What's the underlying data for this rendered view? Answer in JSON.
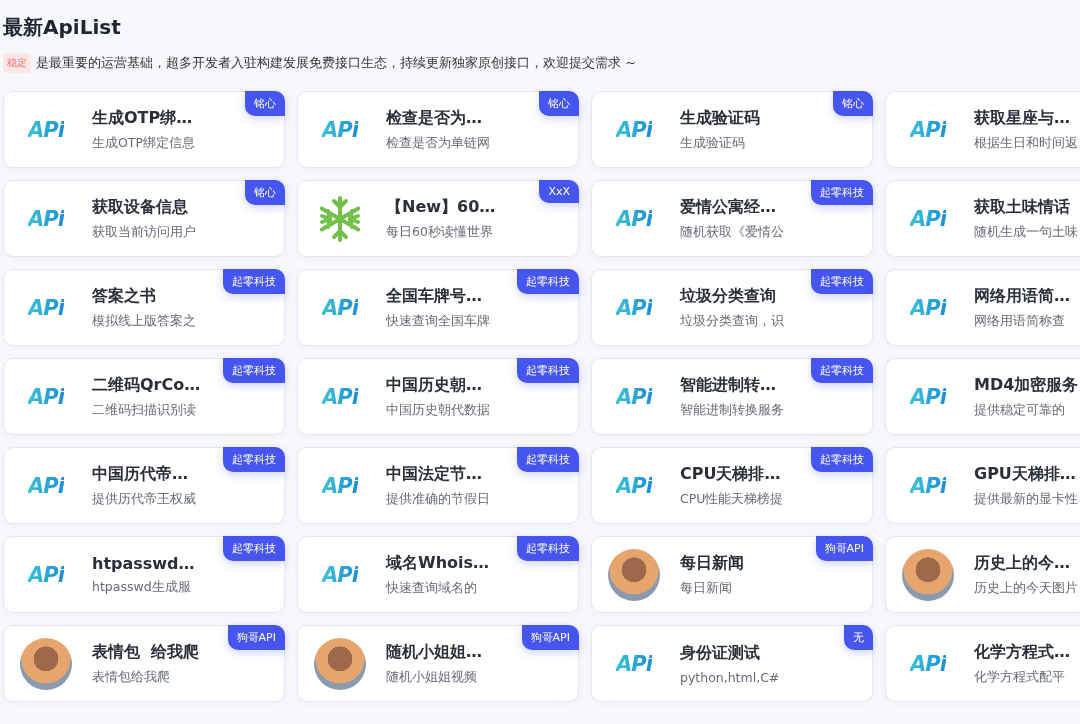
{
  "heading": "最新ApiList",
  "notice": {
    "tag": "稳定",
    "text": "是最重要的运营基础，超多开发者入驻构建发展免费接口生态，持续更新独家原创接口，欢迎提交需求 ~"
  },
  "cards": [
    {
      "kind": "api",
      "logo": "APi",
      "title": "生成OTP绑…",
      "desc": "生成OTP绑定信息",
      "badge": "铭心"
    },
    {
      "kind": "api",
      "logo": "APi",
      "title": "检查是否为…",
      "desc": "检查是否为单链网",
      "badge": "铭心"
    },
    {
      "kind": "api",
      "logo": "APi",
      "title": "生成验证码",
      "desc": "生成验证码",
      "badge": "铭心"
    },
    {
      "kind": "api",
      "logo": "APi",
      "title": "获取星座与…",
      "desc": "根据生日和时间返"
    },
    {
      "kind": "api",
      "logo": "APi",
      "title": "获取设备信息",
      "desc": "获取当前访问用户",
      "badge": "铭心"
    },
    {
      "kind": "snowflake",
      "title": "【New】60…",
      "desc": "每日60秒读懂世界",
      "badge": "XxX"
    },
    {
      "kind": "api",
      "logo": "APi",
      "title": "爱情公寓经…",
      "desc": "随机获取《爱情公",
      "badge": "起零科技"
    },
    {
      "kind": "api",
      "logo": "APi",
      "title": "获取土味情话",
      "desc": "随机生成一句土味"
    },
    {
      "kind": "api",
      "logo": "APi",
      "title": "答案之书",
      "desc": "模拟线上版答案之",
      "badge": "起零科技"
    },
    {
      "kind": "api",
      "logo": "APi",
      "title": "全国车牌号…",
      "desc": "快速查询全国车牌",
      "badge": "起零科技"
    },
    {
      "kind": "api",
      "logo": "APi",
      "title": "垃圾分类查询",
      "desc": "垃圾分类查询，识",
      "badge": "起零科技"
    },
    {
      "kind": "api",
      "logo": "APi",
      "title": "网络用语简…",
      "desc": "网络用语简称查"
    },
    {
      "kind": "api",
      "logo": "APi",
      "title": "二维码QrCo…",
      "desc": "二维码扫描识别读",
      "badge": "起零科技"
    },
    {
      "kind": "api",
      "logo": "APi",
      "title": "中国历史朝…",
      "desc": "中国历史朝代数据",
      "badge": "起零科技"
    },
    {
      "kind": "api",
      "logo": "APi",
      "title": "智能进制转…",
      "desc": "智能进制转换服务",
      "badge": "起零科技"
    },
    {
      "kind": "api",
      "logo": "APi",
      "title": "MD4加密服务",
      "desc": "提供稳定可靠的"
    },
    {
      "kind": "api",
      "logo": "APi",
      "title": "中国历代帝…",
      "desc": "提供历代帝王权威",
      "badge": "起零科技"
    },
    {
      "kind": "api",
      "logo": "APi",
      "title": "中国法定节…",
      "desc": "提供准确的节假日",
      "badge": "起零科技"
    },
    {
      "kind": "api",
      "logo": "APi",
      "title": "CPU天梯排…",
      "desc": "CPU性能天梯榜提",
      "badge": "起零科技"
    },
    {
      "kind": "api",
      "logo": "APi",
      "title": "GPU天梯排…",
      "desc": "提供最新的显卡性"
    },
    {
      "kind": "api",
      "logo": "APi",
      "title": "htpasswd…",
      "desc": "htpasswd生成服",
      "badge": "起零科技"
    },
    {
      "kind": "api",
      "logo": "APi",
      "title": "域名Whois…",
      "desc": "快速查询域名的",
      "badge": "起零科技"
    },
    {
      "kind": "avatar",
      "title": "每日新闻",
      "desc": "每日新闻",
      "badge": "狗哥API"
    },
    {
      "kind": "avatar",
      "title": "历史上的今…",
      "desc": "历史上的今天图片"
    },
    {
      "kind": "avatar",
      "title": "表情包  给我爬",
      "desc": "表情包给我爬",
      "badge": "狗哥API"
    },
    {
      "kind": "avatar",
      "title": "随机小姐姐…",
      "desc": "随机小姐姐视频",
      "badge": "狗哥API"
    },
    {
      "kind": "api",
      "logo": "APi",
      "title": "身份证测试",
      "desc": "python,html,C#",
      "badge": "无"
    },
    {
      "kind": "api",
      "logo": "APi",
      "title": "化学方程式…",
      "desc": "化学方程式配平"
    }
  ]
}
